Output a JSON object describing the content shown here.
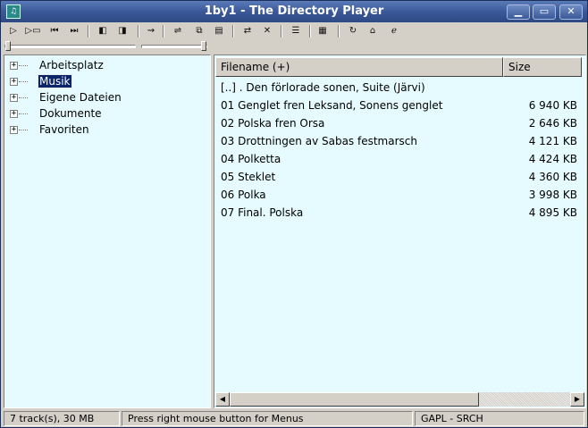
{
  "window": {
    "title": "1by1 - The Directory Player",
    "app_icon": "music-note-icon",
    "minimize_glyph": "▁",
    "maximize_glyph": "▭",
    "close_glyph": "✕"
  },
  "toolbar": {
    "play": "▷",
    "play_next": "▷▭",
    "prev_track": "⏮",
    "next_track": "⏭",
    "prev_dir": "◧",
    "next_dir": "◨",
    "shuffle": "⇝",
    "eq": "⇌",
    "copy": "⧉",
    "info": "▤",
    "repeat": "⇄",
    "stop_clear": "✕",
    "align": "☰",
    "playlist": "▦",
    "reload": "↻",
    "home": "⌂",
    "power": "ℯ"
  },
  "sliders": {
    "position": 0.0,
    "volume": 1.0
  },
  "tree": {
    "items": [
      {
        "label": "Arbeitsplatz",
        "expander": "+"
      },
      {
        "label": "Musik",
        "expander": "+"
      },
      {
        "label": "Eigene Dateien",
        "expander": "+"
      },
      {
        "label": "Dokumente",
        "expander": "+"
      },
      {
        "label": "Favoriten",
        "expander": "+"
      }
    ]
  },
  "list": {
    "columns": [
      "Filename (+)",
      "Size"
    ],
    "rows": [
      {
        "name": "[..]  . Den förlorade sonen, Suite (Järvi)",
        "size": ""
      },
      {
        "name": "01 Genglet fren Leksand, Sonens genglet",
        "size": "6 940 KB"
      },
      {
        "name": "02 Polska fren Orsa",
        "size": "2 646 KB"
      },
      {
        "name": "03 Drottningen av Sabas festmarsch",
        "size": "4 121 KB"
      },
      {
        "name": "04 Polketta",
        "size": "4 424 KB"
      },
      {
        "name": "05 Steklet",
        "size": "4 360 KB"
      },
      {
        "name": "06 Polka",
        "size": "3 998 KB"
      },
      {
        "name": "07 Final. Polska",
        "size": "4 895 KB"
      }
    ],
    "scroll_left_glyph": "◀",
    "scroll_right_glyph": "▶"
  },
  "status": {
    "tracks": "7 track(s), 30 MB",
    "hint": "Press right mouse button for Menus",
    "mode": "GAPL - SRCH"
  },
  "colors": {
    "pane_bg": "#e6fbff",
    "selection": "#0a246a",
    "titlebar": "#3b5998"
  }
}
